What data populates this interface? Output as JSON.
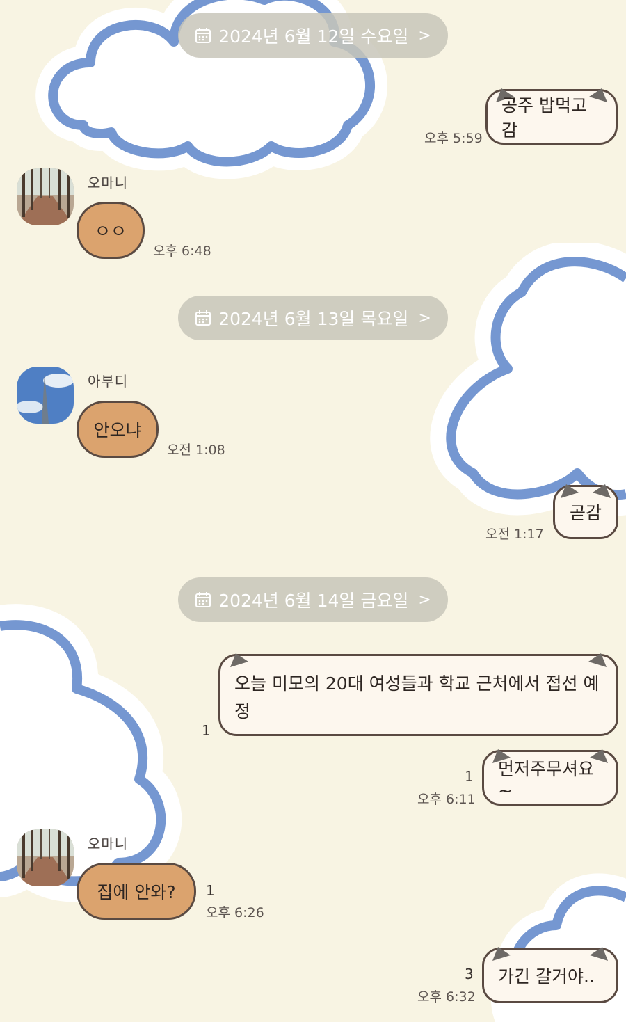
{
  "colors": {
    "background": "#f8f4e3",
    "cloud_outline": "#7597d1",
    "mine_bubble": "#fdf7ee",
    "their_bubble": "#dba36e",
    "chip": "#c8c5ba"
  },
  "dates": [
    {
      "label": "2024년 6월 12일 수요일",
      "icon": "calendar-icon",
      "chevron": ">"
    },
    {
      "label": "2024년 6월 13일 목요일",
      "icon": "calendar-icon",
      "chevron": ">"
    },
    {
      "label": "2024년 6월 14일 금요일",
      "icon": "calendar-icon",
      "chevron": ">"
    }
  ],
  "messages": [
    {
      "text": "공주 밥먹고감",
      "time": "오후 5:59"
    },
    {
      "sender": "오마니",
      "text": "ㅇㅇ",
      "time": "오후 6:48"
    },
    {
      "sender": "아부디",
      "text": "안오냐",
      "time": "오전 1:08"
    },
    {
      "text": "곧감",
      "time": "오전 1:17"
    },
    {
      "text": "오늘 미모의 20대 여성들과 학교 근처에서 접선 예정",
      "unread": "1"
    },
    {
      "text": "먼저주무셔요~",
      "unread": "1",
      "time": "오후 6:11"
    },
    {
      "sender": "오마니",
      "text": "집에 안와?",
      "unread": "1",
      "time": "오후 6:26"
    },
    {
      "text": "가긴 갈거야..",
      "unread": "3",
      "time": "오후 6:32"
    }
  ]
}
